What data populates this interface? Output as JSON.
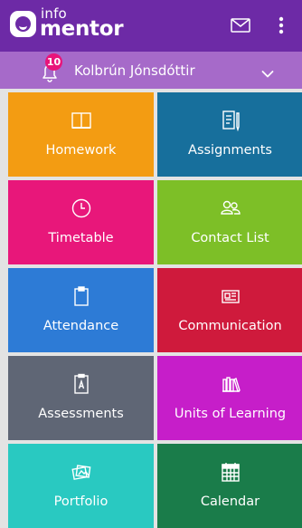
{
  "header": {
    "logo_info": "info",
    "logo_mentor": "mentor",
    "mail_icon": "envelope-icon",
    "menu_icon": "vertical-dots-icon"
  },
  "userbar": {
    "notification_count": "10",
    "user_name": "Kolbrún Jónsdóttir",
    "dropdown_icon": "chevron-down-icon"
  },
  "tiles": [
    {
      "label": "Homework",
      "icon": "book-icon",
      "color": "#f39c12"
    },
    {
      "label": "Assignments",
      "icon": "notebook-pen-icon",
      "color": "#176f9c"
    },
    {
      "label": "Timetable",
      "icon": "clock-icon",
      "color": "#e8177a"
    },
    {
      "label": "Contact List",
      "icon": "people-icon",
      "color": "#7dbf27"
    },
    {
      "label": "Attendance",
      "icon": "clipboard-icon",
      "color": "#2d7bd6"
    },
    {
      "label": "Communication",
      "icon": "newspaper-icon",
      "color": "#cf1a3c"
    },
    {
      "label": "Assessments",
      "icon": "graded-clipboard-icon",
      "color": "#5f6675"
    },
    {
      "label": "Units of Learning",
      "icon": "books-icon",
      "color": "#c61ec9"
    },
    {
      "label": "Portfolio",
      "icon": "photos-icon",
      "color": "#29c9c1"
    },
    {
      "label": "Calendar",
      "icon": "calendar-icon",
      "color": "#1a7c4a"
    }
  ],
  "colors": {
    "topbar": "#6d2aa6",
    "userbar": "#a66ac9",
    "badge": "#e8147a",
    "background": "#e3e3e3"
  }
}
